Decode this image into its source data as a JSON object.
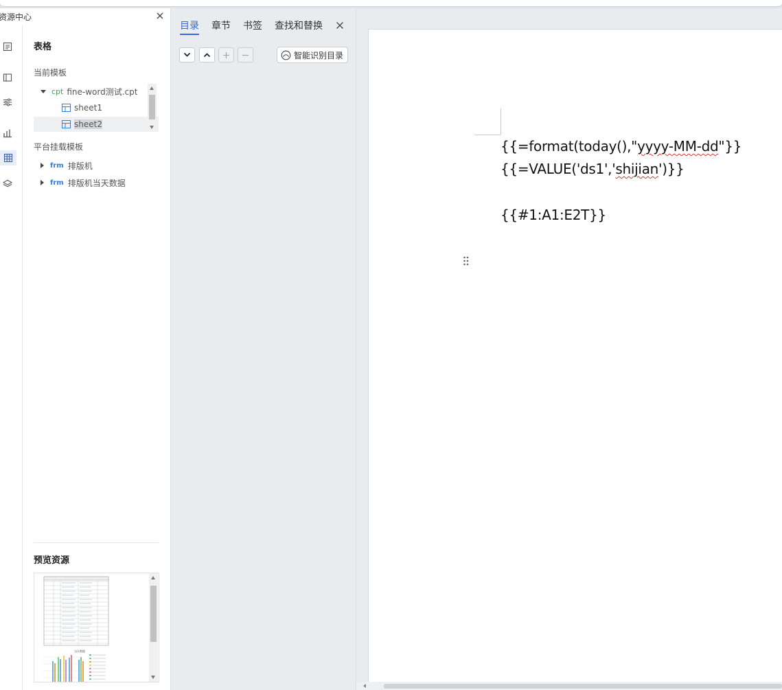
{
  "resource_panel": {
    "title": "资源中心",
    "section_title": "表格",
    "current_template_label": "当前模板",
    "current_template": {
      "type_tag": "cpt",
      "name": "fine-word测试.cpt",
      "sheets": [
        "sheet1",
        "sheet2"
      ],
      "selected_sheet_index": 1
    },
    "platform_template_label": "平台挂载模板",
    "platform_templates": [
      {
        "type_tag": "frm",
        "name": "排版机"
      },
      {
        "type_tag": "frm",
        "name": "排版机当天数据"
      }
    ],
    "preview_title": "预览资源"
  },
  "rail_icons": [
    "outline-icon",
    "component-icon",
    "settings-sliders-icon",
    "chart-icon",
    "table-icon",
    "layers-icon"
  ],
  "nav_panel": {
    "tabs": [
      "目录",
      "章节",
      "书签",
      "查找和替换"
    ],
    "active_tab_index": 0,
    "smart_toc_label": "智能识别目录"
  },
  "document": {
    "line1_prefix": "{{=format(today(),\"",
    "line1_squiggle": "yyyy-MM-dd",
    "line1_suffix": "\"}}",
    "line2_prefix": "{{=VALUE('ds1','",
    "line2_squiggle": "shijian",
    "line2_suffix": "')}}",
    "line3": "{{#1:A1:E2T}}"
  },
  "colors": {
    "accent": "#2f6bd8",
    "cpt_tag": "#3ba55c",
    "frm_tag": "#2f7de1",
    "spell_error": "#dd3333"
  }
}
